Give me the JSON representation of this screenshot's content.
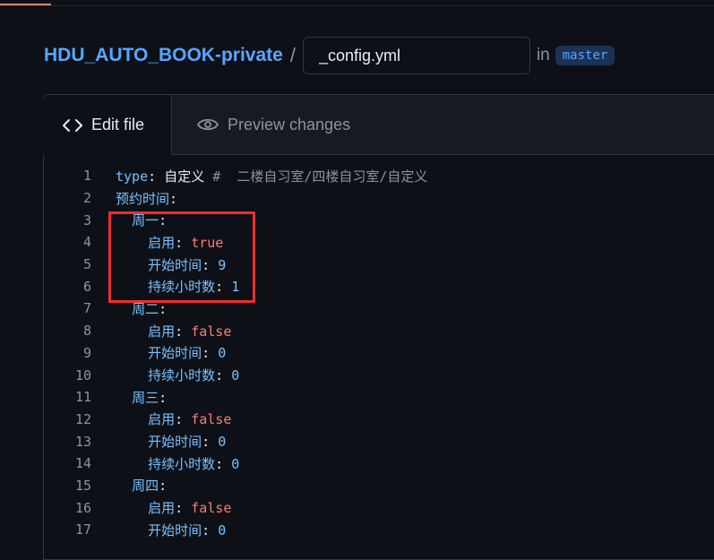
{
  "breadcrumb": {
    "repo": "HDU_AUTO_BOOK-private",
    "separator": "/",
    "filename": "_config.yml",
    "in_label": "in",
    "branch": "master"
  },
  "tabs": {
    "edit": "Edit file",
    "preview": "Preview changes"
  },
  "code_lines": [
    {
      "num": "1",
      "indent": "",
      "key": "type",
      "colon": ": ",
      "value": "自定义",
      "value_type": "plain",
      "comment": " #  二楼自习室/四楼自习室/自定义"
    },
    {
      "num": "2",
      "indent": "",
      "key": "预约时间",
      "colon": ":",
      "value": "",
      "value_type": "plain",
      "comment": ""
    },
    {
      "num": "3",
      "indent": "  ",
      "key": "周一",
      "colon": ":",
      "value": "",
      "value_type": "plain",
      "comment": ""
    },
    {
      "num": "4",
      "indent": "    ",
      "key": "启用",
      "colon": ": ",
      "value": "true",
      "value_type": "bool",
      "comment": ""
    },
    {
      "num": "5",
      "indent": "    ",
      "key": "开始时间",
      "colon": ": ",
      "value": "9",
      "value_type": "number",
      "comment": ""
    },
    {
      "num": "6",
      "indent": "    ",
      "key": "持续小时数",
      "colon": ": ",
      "value": "1",
      "value_type": "number",
      "comment": ""
    },
    {
      "num": "7",
      "indent": "  ",
      "key": "周二",
      "colon": ":",
      "value": "",
      "value_type": "plain",
      "comment": ""
    },
    {
      "num": "8",
      "indent": "    ",
      "key": "启用",
      "colon": ": ",
      "value": "false",
      "value_type": "bool",
      "comment": ""
    },
    {
      "num": "9",
      "indent": "    ",
      "key": "开始时间",
      "colon": ": ",
      "value": "0",
      "value_type": "number",
      "comment": ""
    },
    {
      "num": "10",
      "indent": "    ",
      "key": "持续小时数",
      "colon": ": ",
      "value": "0",
      "value_type": "number",
      "comment": ""
    },
    {
      "num": "11",
      "indent": "  ",
      "key": "周三",
      "colon": ":",
      "value": "",
      "value_type": "plain",
      "comment": ""
    },
    {
      "num": "12",
      "indent": "    ",
      "key": "启用",
      "colon": ": ",
      "value": "false",
      "value_type": "bool",
      "comment": ""
    },
    {
      "num": "13",
      "indent": "    ",
      "key": "开始时间",
      "colon": ": ",
      "value": "0",
      "value_type": "number",
      "comment": ""
    },
    {
      "num": "14",
      "indent": "    ",
      "key": "持续小时数",
      "colon": ": ",
      "value": "0",
      "value_type": "number",
      "comment": ""
    },
    {
      "num": "15",
      "indent": "  ",
      "key": "周四",
      "colon": ":",
      "value": "",
      "value_type": "plain",
      "comment": ""
    },
    {
      "num": "16",
      "indent": "    ",
      "key": "启用",
      "colon": ": ",
      "value": "false",
      "value_type": "bool",
      "comment": ""
    },
    {
      "num": "17",
      "indent": "    ",
      "key": "开始时间",
      "colon": ": ",
      "value": "0",
      "value_type": "number",
      "comment": ""
    }
  ],
  "colors": {
    "key": "#79c0ff",
    "bool": "#ff7b72",
    "number": "#79c0ff",
    "comment": "#8b949e",
    "highlight": "#f02d2d"
  },
  "icons": {
    "edit_tab": "code-icon",
    "preview_tab": "eye-icon"
  }
}
